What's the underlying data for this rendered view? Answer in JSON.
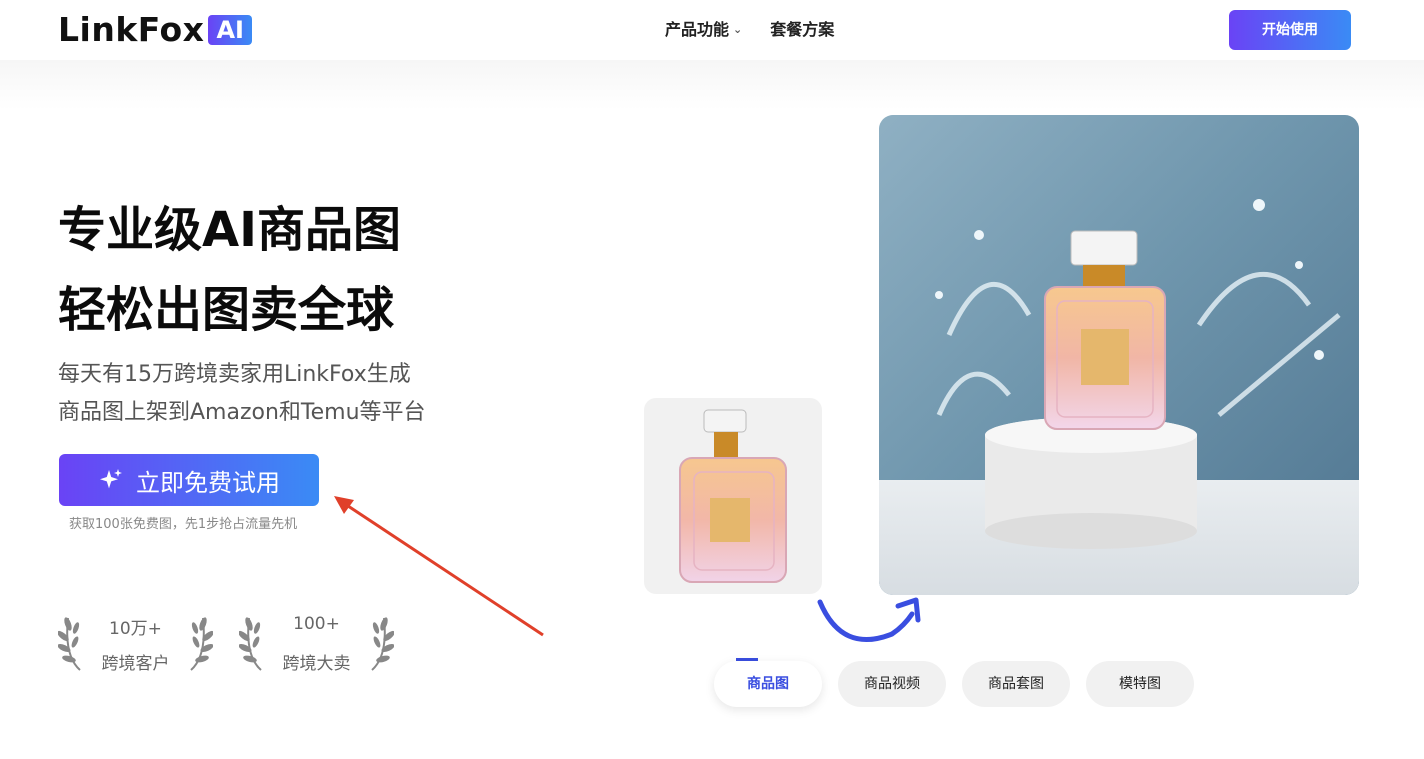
{
  "header": {
    "logo_text": "LinkFox",
    "logo_badge": "AI",
    "nav": [
      {
        "label": "产品功能",
        "has_dropdown": true
      },
      {
        "label": "套餐方案",
        "has_dropdown": false
      }
    ],
    "cta_label": "开始使用"
  },
  "hero": {
    "headline_line1": "专业级AI商品图",
    "headline_line2": "轻松出图卖全球",
    "sub_line1": "每天有15万跨境卖家用LinkFox生成",
    "sub_line2": "商品图上架到Amazon和Temu等平台",
    "try_button": "立即免费试用",
    "try_note": "获取100张免费图，先1步抢占流量先机"
  },
  "stats": [
    {
      "number": "10万+",
      "label": "跨境客户"
    },
    {
      "number": "100+",
      "label": "跨境大卖"
    }
  ],
  "tabs": [
    "商品图",
    "商品视频",
    "商品套图",
    "模特图"
  ],
  "active_tab": 0,
  "colors": {
    "brand_start": "#6a43f5",
    "brand_end": "#3a8bf5",
    "accent_blue": "#3a4ee0",
    "annotation_red": "#e0402a"
  }
}
